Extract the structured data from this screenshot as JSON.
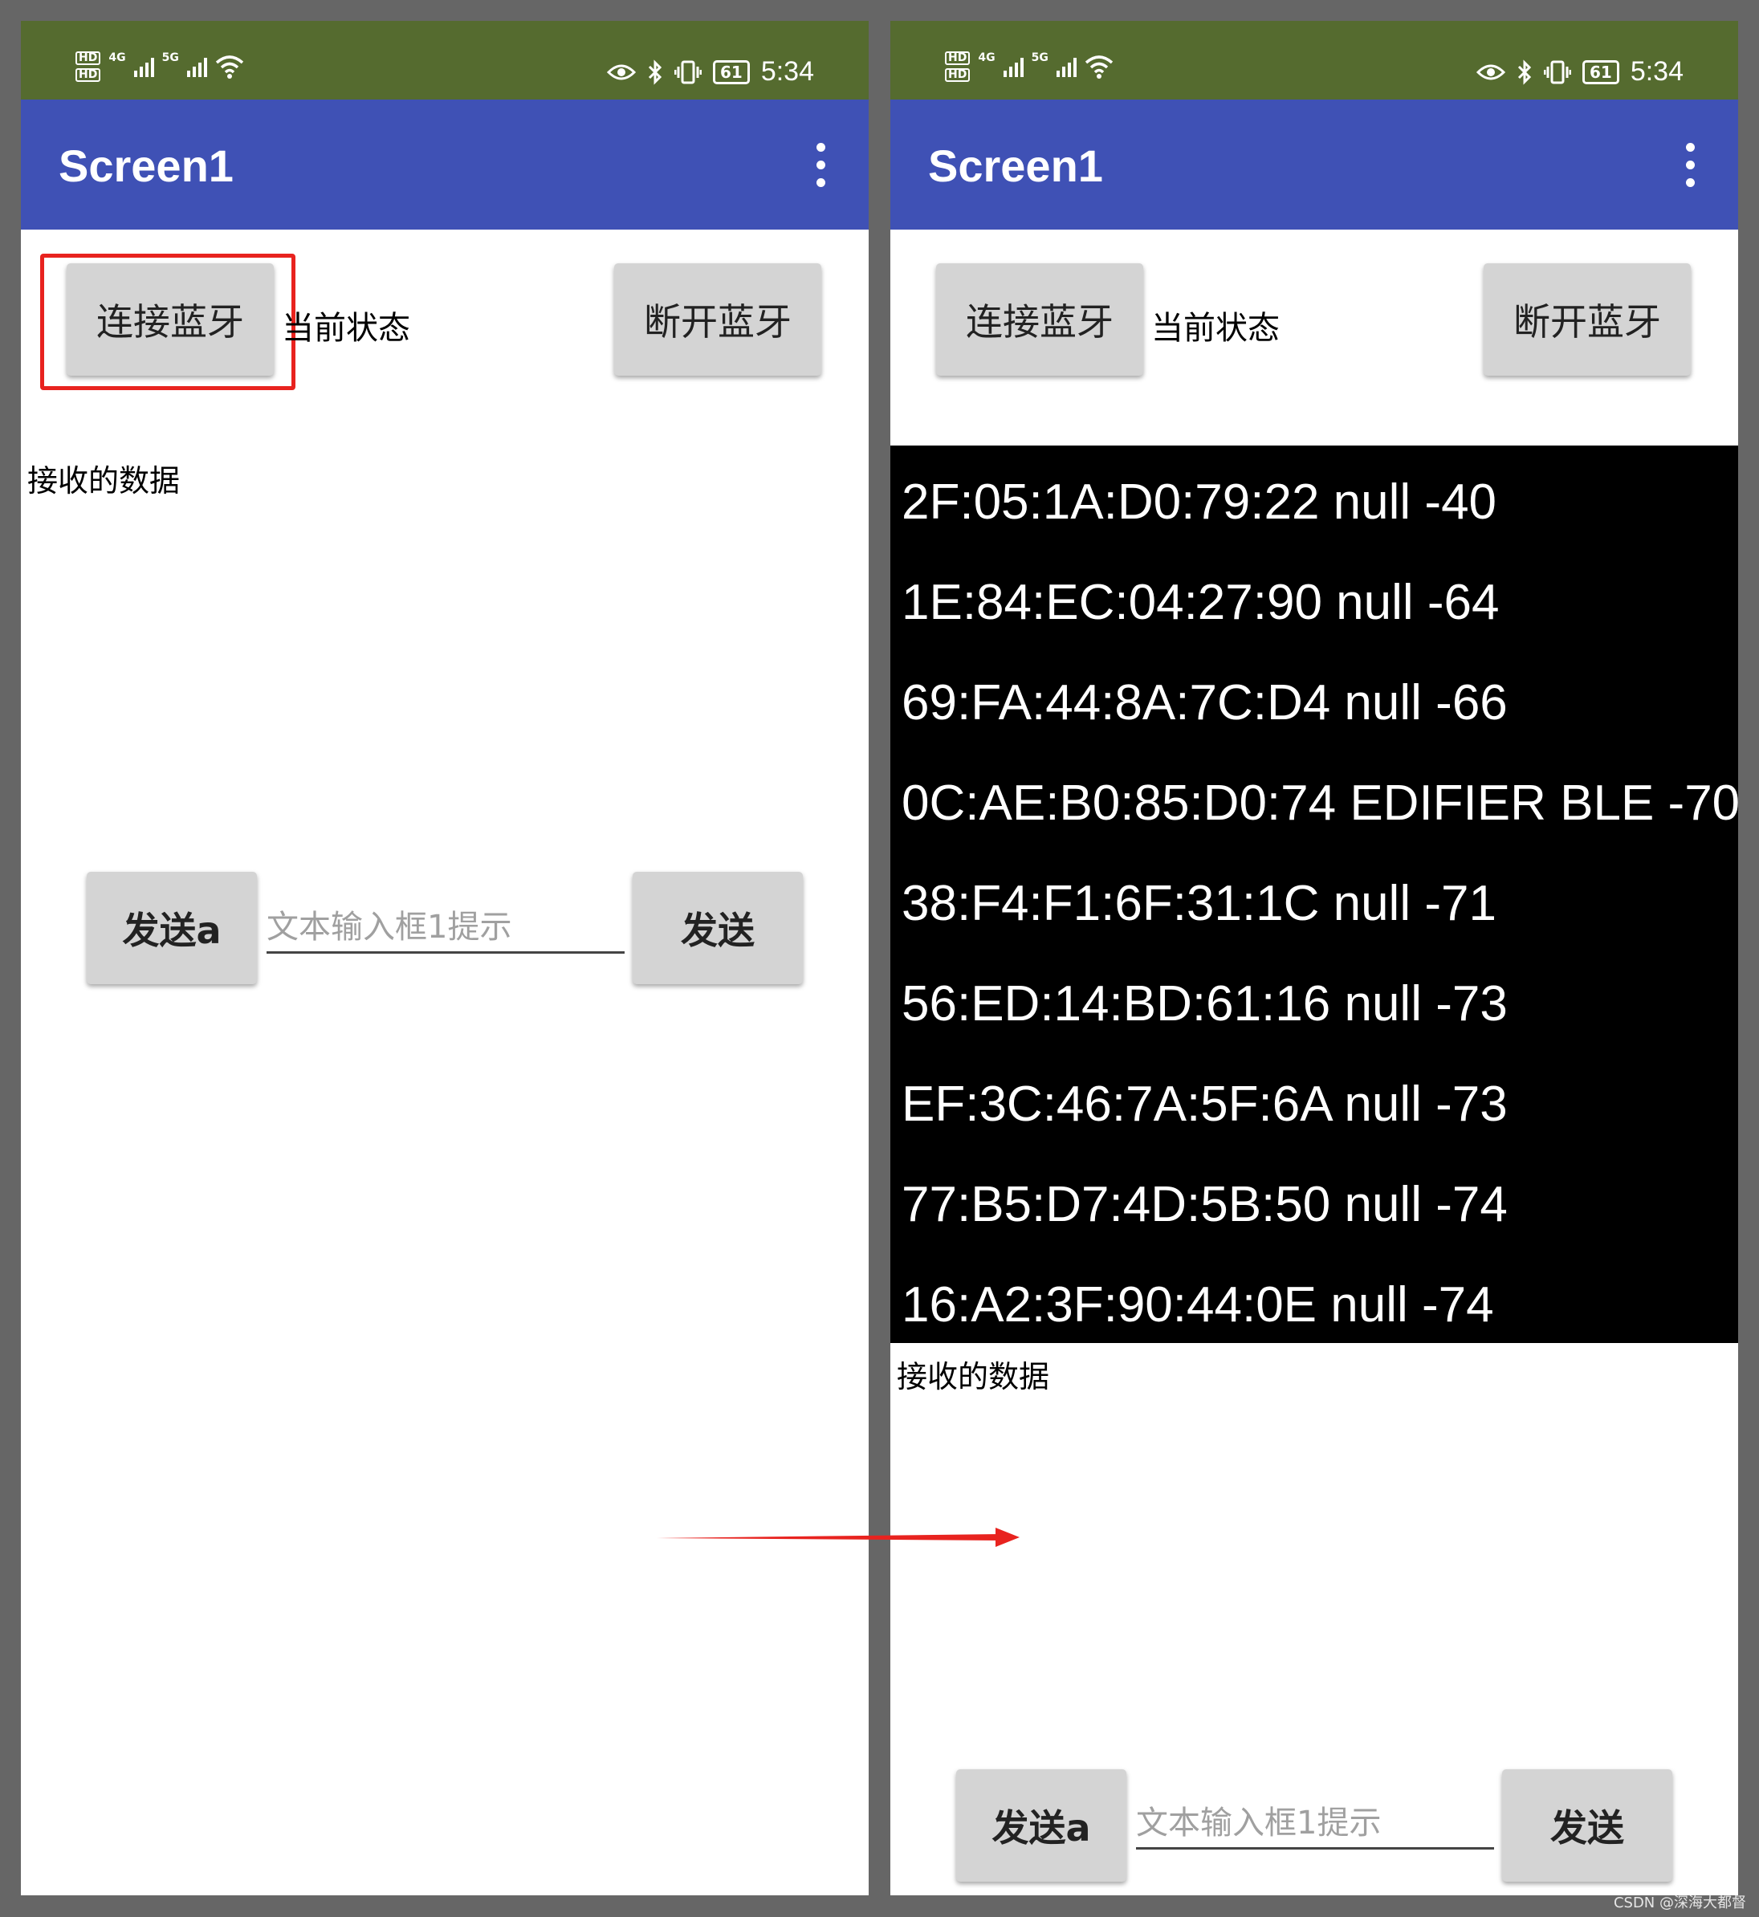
{
  "status_bar": {
    "hd_label": "HD",
    "net_4g": "4G",
    "net_5g": "5G",
    "battery": "61",
    "time": "5:34"
  },
  "app": {
    "title": "Screen1"
  },
  "buttons": {
    "connect": "连接蓝牙",
    "disconnect": "断开蓝牙",
    "send_a": "发送a",
    "send": "发送"
  },
  "labels": {
    "current_status": "当前状态",
    "received_data": "接收的数据"
  },
  "text_input": {
    "placeholder": "文本输入框1提示"
  },
  "device_list": [
    "2F:05:1A:D0:79:22 null -40",
    "1E:84:EC:04:27:90 null -64",
    "69:FA:44:8A:7C:D4 null -66",
    "0C:AE:B0:85:D0:74 EDIFIER BLE -70",
    "38:F4:F1:6F:31:1C null -71",
    "56:ED:14:BD:61:16 null -73",
    "EF:3C:46:7A:5F:6A null -73",
    "77:B5:D7:4D:5B:50 null -74",
    "16:A2:3F:90:44:0E null -74"
  ],
  "watermark": "CSDN @深海大都督",
  "colors": {
    "status_bar": "#556b2f",
    "title_bar": "#3f51b5",
    "button": "#d4d4d4",
    "highlight": "#e8231f",
    "list_bg": "#000000"
  },
  "icons": [
    "eye-icon",
    "bluetooth-icon",
    "vibrate-icon",
    "battery-icon",
    "wifi-icon",
    "signal-icon",
    "overflow-menu-icon",
    "arrow-right-icon"
  ]
}
